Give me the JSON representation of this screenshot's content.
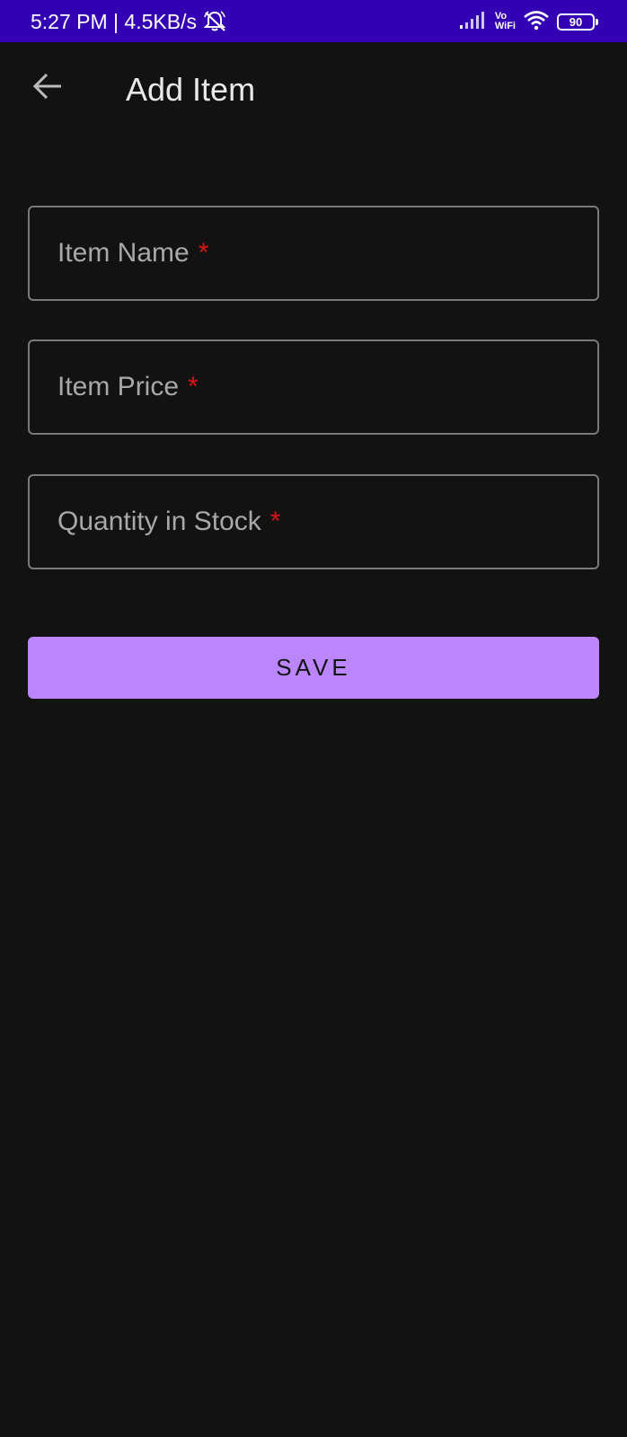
{
  "status_bar": {
    "time_speed": "5:27 PM | 4.5KB/s",
    "vowifi_line1": "Vo",
    "vowifi_line2": "WiFi",
    "battery": "90",
    "icons": [
      "bell-off-icon",
      "signal-icon",
      "wifi-icon",
      "battery-icon"
    ],
    "background_color": "#3400b4"
  },
  "app_bar": {
    "title": "Add Item",
    "back_icon": "arrow-back-icon"
  },
  "form": {
    "fields": [
      {
        "label": "Item Name",
        "required_mark": "*",
        "value": ""
      },
      {
        "label": "Item Price",
        "required_mark": "*",
        "value": ""
      },
      {
        "label": "Quantity in Stock",
        "required_mark": "*",
        "value": ""
      }
    ],
    "save_label": "SAVE"
  },
  "colors": {
    "background": "#121212",
    "accent": "#bb86fc",
    "required": "#d81515",
    "field_border": "#7a7a7a"
  }
}
